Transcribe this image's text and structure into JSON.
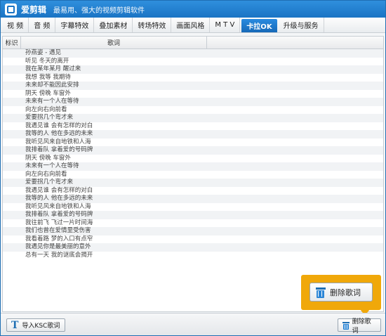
{
  "window": {
    "title": "爱剪辑",
    "subtitle": "最易用、强大的视频剪辑软件"
  },
  "tabs": [
    {
      "label": "视  频"
    },
    {
      "label": "音  频"
    },
    {
      "label": "字幕特效"
    },
    {
      "label": "叠加素材"
    },
    {
      "label": "转场特效"
    },
    {
      "label": "画面风格"
    },
    {
      "label": "M T V"
    },
    {
      "label": "卡拉OK",
      "active": true
    },
    {
      "label": "升级与服务"
    }
  ],
  "table": {
    "headers": {
      "index": "标识",
      "lyric": "歌词"
    },
    "rows": [
      "孙燕姿 - 遇见",
      "听见 冬天的离开",
      "我在某年某月 醒过来",
      "我想 我等 我期待",
      "未来却不能因此安排",
      "阴天 傍晚 车窗外",
      "未来有一个人在等待",
      "向左向右向前看",
      "爱要拐几个弯才来",
      "我遇见谁 会有怎样的对白",
      "我等的人 他在多远的未来",
      "我听见风来自地铁和人海",
      "我排着队 拿着爱的号码牌",
      "阴天 傍晚 车窗外",
      "未来有一个人在等待",
      "向左向右向前看",
      "爱要拐几个弯才来",
      "我遇见谁 会有怎样的对白",
      "我等的人 他在多远的未来",
      "我听见风来自地铁和人海",
      "我排着队 拿着爱的号码牌",
      "我往前飞 飞过一片时间海",
      "我们也曾在爱情里受伤害",
      "我看着路 梦的入口有点窄",
      "我遇见你是最美丽的意外",
      "总有一天 我的谜底会揭开"
    ]
  },
  "buttons": {
    "import": "导入KSC歌词",
    "delete": "删除歌词",
    "callout_delete": "删除歌词"
  },
  "colors": {
    "accent": "#1a74c4",
    "callout": "#f0a80a"
  },
  "icons": {
    "import": "text-t-icon",
    "delete": "trash-icon"
  }
}
